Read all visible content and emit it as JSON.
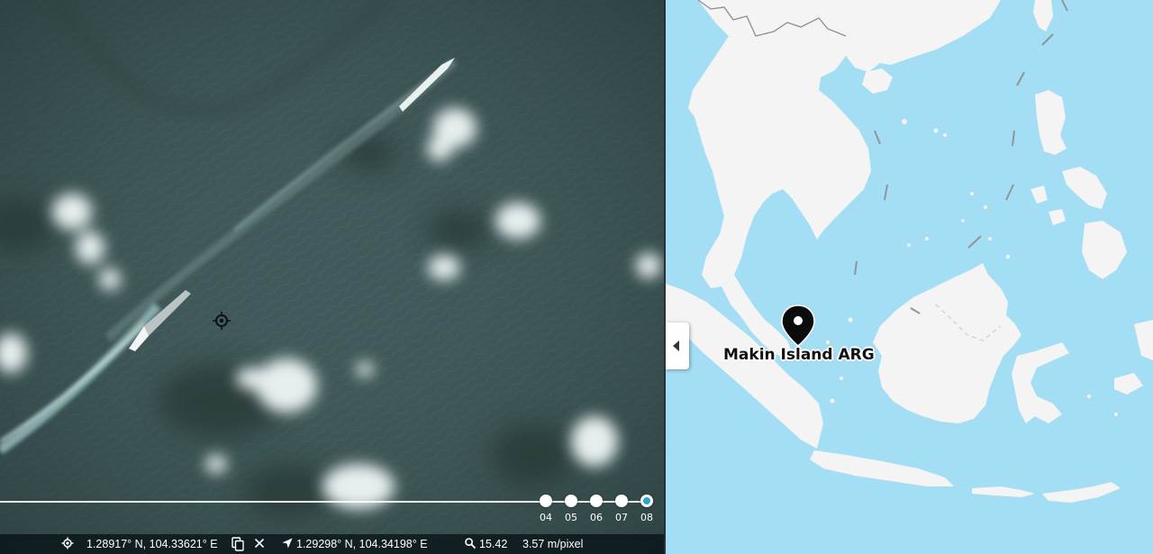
{
  "satellite": {
    "timeline": {
      "dates": [
        "04",
        "05",
        "06",
        "07",
        "08"
      ],
      "active_index": 4
    },
    "status": {
      "cursor_coords": "1.28917° N, 104.33621° E",
      "target_coords": "1.29298° N, 104.34198° E",
      "zoom_level": "15.42",
      "resolution": "3.57 m/pixel"
    }
  },
  "map": {
    "marker": {
      "label": "Makin Island ARG",
      "icon": "map-pin-icon"
    }
  },
  "colors": {
    "ocean": "#a4def5",
    "land": "#f4f4f4",
    "sea_dark": "#3c5553",
    "accent": "#2aa6c8"
  }
}
